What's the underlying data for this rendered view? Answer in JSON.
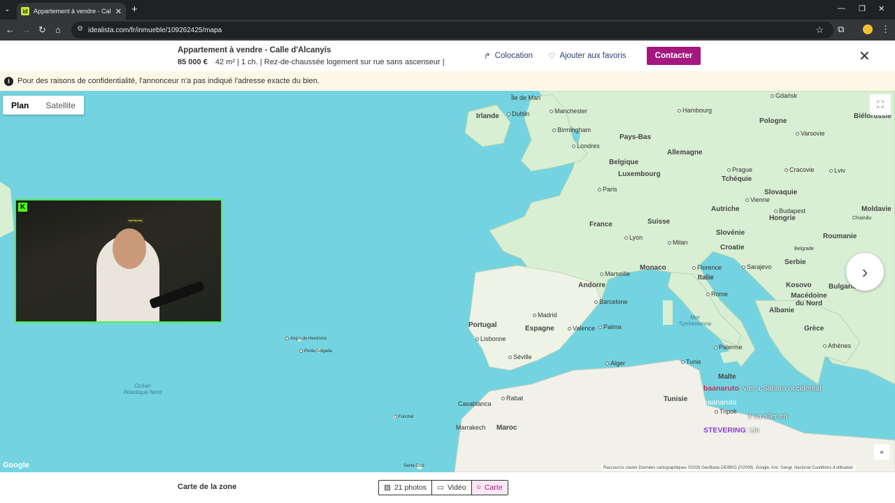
{
  "browser": {
    "tab_title": "Appartement à vendre - Calle d",
    "favicon_letter": "id",
    "url": "idealista.com/fr/inmueble/109262425/mapa"
  },
  "listing": {
    "title": "Appartement à vendre - Calle d'Alcanyís",
    "price": "85 000 €",
    "details": "42 m² | 1 ch. | Rez-de-chaussée logement sur rue sans ascenseur |",
    "colocation": "Colocation",
    "favorites": "Ajouter aux favoris",
    "contact": "Contacter"
  },
  "notice": "Pour des raisons de confidentialité, l'annonceur n'a pas indiqué l'adresse exacte du bien.",
  "map": {
    "toggle": [
      "Plan",
      "Satellite"
    ],
    "countries": [
      "Irlande",
      "Pays-Bas",
      "Allemagne",
      "Pologne",
      "Biélorussie",
      "Belgique",
      "Luxembourg",
      "Tchéquie",
      "Slovaquie",
      "Moldavie",
      "France",
      "Suisse",
      "Autriche",
      "Hongrie",
      "Slovénie",
      "Roumanie",
      "Croatie",
      "Serbie",
      "Monaco",
      "Italie",
      "Andorre",
      "Kosovo",
      "Bulgarie",
      "Macédoine du Nord",
      "Albanie",
      "Portugal",
      "Espagne",
      "Grèce",
      "Tunisie",
      "Malte",
      "Maroc",
      "Île de Man"
    ],
    "cities": [
      "Dublin",
      "Manchester",
      "Birmingham",
      "Londres",
      "Hambourg",
      "Gdańsk",
      "Varsovie",
      "Paris",
      "Prague",
      "Cracovie",
      "Lviv",
      "Vienne",
      "Budapest",
      "Lyon",
      "Milan",
      "Marseille",
      "Florence",
      "Rome",
      "Barcelone",
      "Madrid",
      "Valence",
      "Palma",
      "Lisbonne",
      "Séville",
      "Alger",
      "Tunis",
      "Palerme",
      "Athènes",
      "Rabat",
      "Casablanca",
      "Marrakech",
      "Sarajevo",
      "Belgrade",
      "Chișinău",
      "Angra do Heroísmo",
      "Ponta Delgada",
      "Funchal",
      "Tripoli",
      "Santa Cruz"
    ],
    "sea_label": "Océan Atlantique Nord",
    "med_label": "Mer Tyrrhénienne",
    "attribution": "Raccourcis clavier   Données cartographiques ©2026 GeoBasis-DE/BKG (©2009), Google, Inst. Geogr. Nacional   Conditions d'utilisation",
    "google": "Google"
  },
  "chat": [
    {
      "user": "baanaruto",
      "msg": ": vas a Sahara occidental"
    },
    {
      "user": "baanaruto",
      "msg": ""
    },
    {
      "user": "",
      "msg": "il va aller en"
    },
    {
      "user": "STEVERING",
      "msg": ": Un"
    }
  ],
  "footer": {
    "caption": "Carte de la zone",
    "photos": "21 photos",
    "video": "Vidéo",
    "map": "Carte"
  },
  "colors": {
    "accent": "#a3177f",
    "sea": "#74d3e0",
    "land": "#d8efd4"
  }
}
